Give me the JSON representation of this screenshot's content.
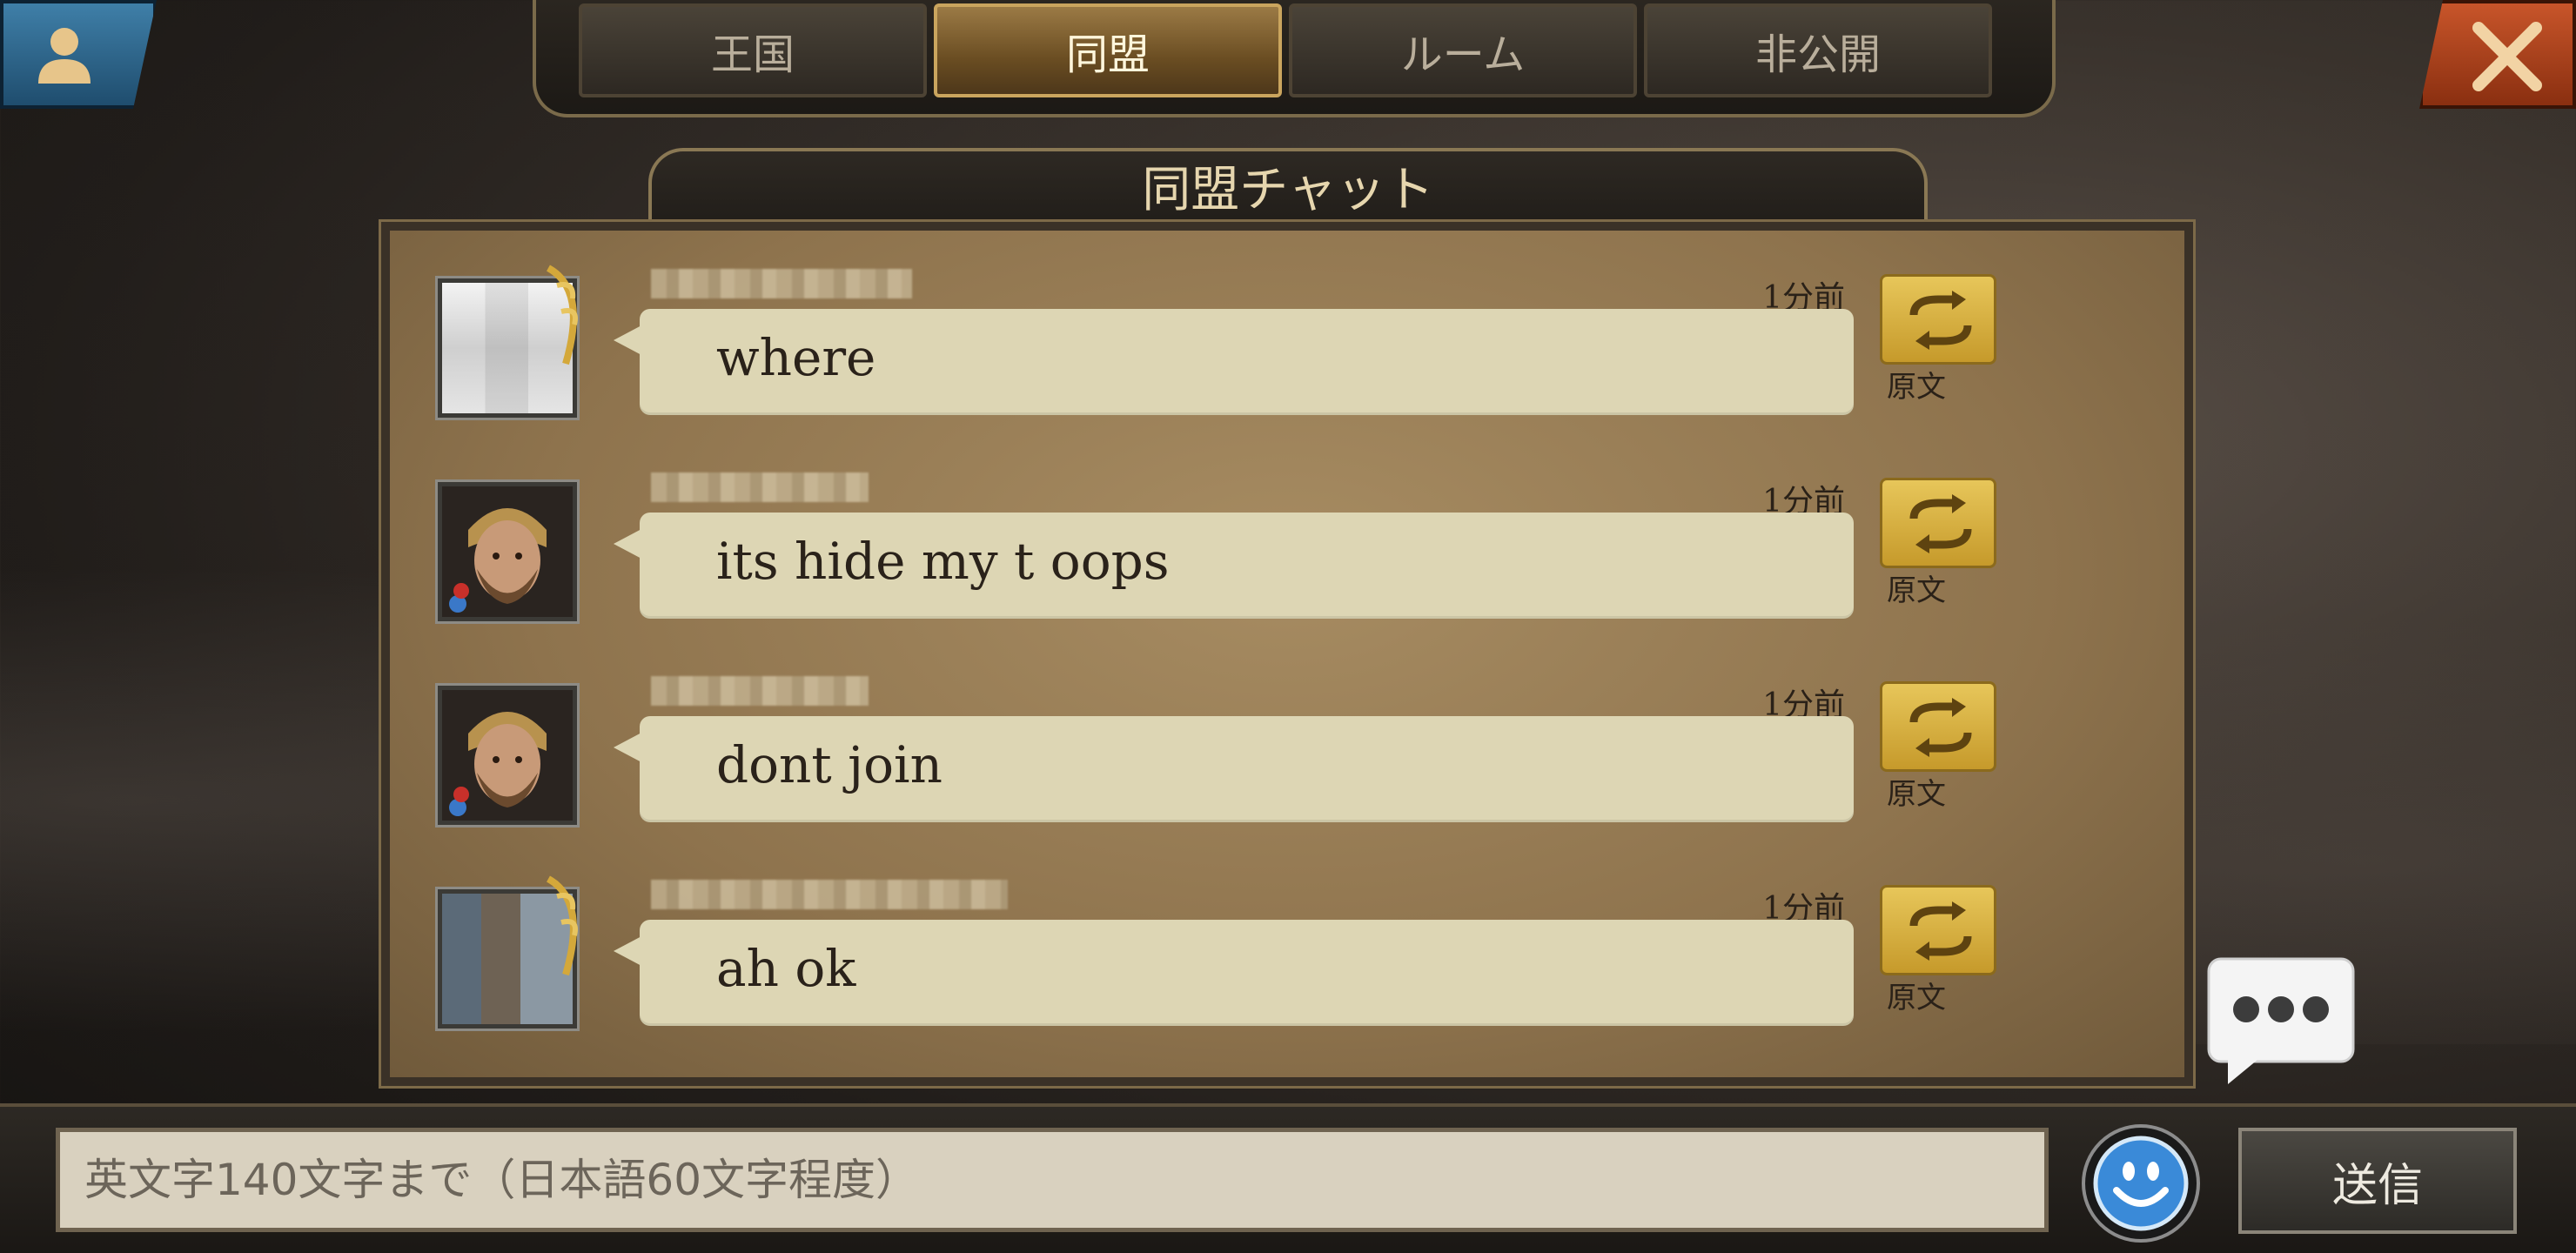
{
  "tabs": [
    {
      "label": "王国",
      "active": false
    },
    {
      "label": "同盟",
      "active": true
    },
    {
      "label": "ルーム",
      "active": false
    },
    {
      "label": "非公開",
      "active": false
    }
  ],
  "panel": {
    "title": "同盟チャット"
  },
  "messages": [
    {
      "avatar": "pixelated-avatar",
      "time": "1分前",
      "text": "where",
      "translate_label": "原文"
    },
    {
      "avatar": "bearded-man-avatar",
      "time": "1分前",
      "text": "its hide my t oops",
      "translate_label": "原文"
    },
    {
      "avatar": "bearded-man-avatar",
      "time": "1分前",
      "text": "dont join",
      "translate_label": "原文"
    },
    {
      "avatar": "pixelated-avatar",
      "time": "1分前",
      "text": "ah ok",
      "translate_label": "原文"
    }
  ],
  "input": {
    "placeholder": "英文字140文字まで（日本語60文字程度）"
  },
  "send_label": "送信",
  "icons": {
    "profile": "user-icon",
    "close": "close-icon",
    "translate": "translate-icon",
    "more": "more-options-icon",
    "emoji": "emoji-icon"
  },
  "colors": {
    "accent_gold": "#caa55e",
    "panel_bg": "#8e734d",
    "bubble_bg": "#ddd6b4",
    "translate_gold": "#c69a2b",
    "close_red": "#c8552a",
    "profile_blue": "#3f7fa8"
  }
}
